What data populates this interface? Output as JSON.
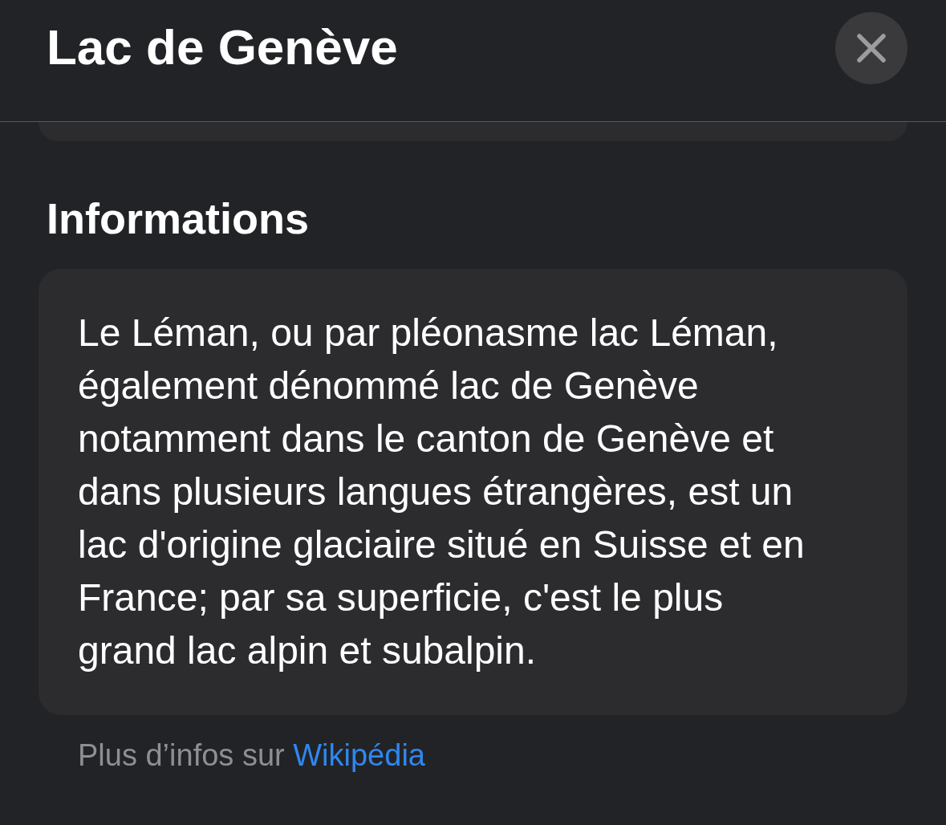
{
  "header": {
    "title": "Lac de Genève"
  },
  "section": {
    "heading": "Informations",
    "description_lines": [
      "Le Léman, ou par pléonasme lac Léman,",
      "également dénommé lac de Genève",
      "notamment dans le canton de Genève et",
      "dans plusieurs langues étrangères, est un",
      "lac d'origine glaciaire situé en Suisse et en",
      "France; par sa superficie, c'est le plus",
      "grand lac alpin et subalpin."
    ]
  },
  "source": {
    "prefix": "Plus d’infos sur",
    "link": "Wikipédia"
  }
}
